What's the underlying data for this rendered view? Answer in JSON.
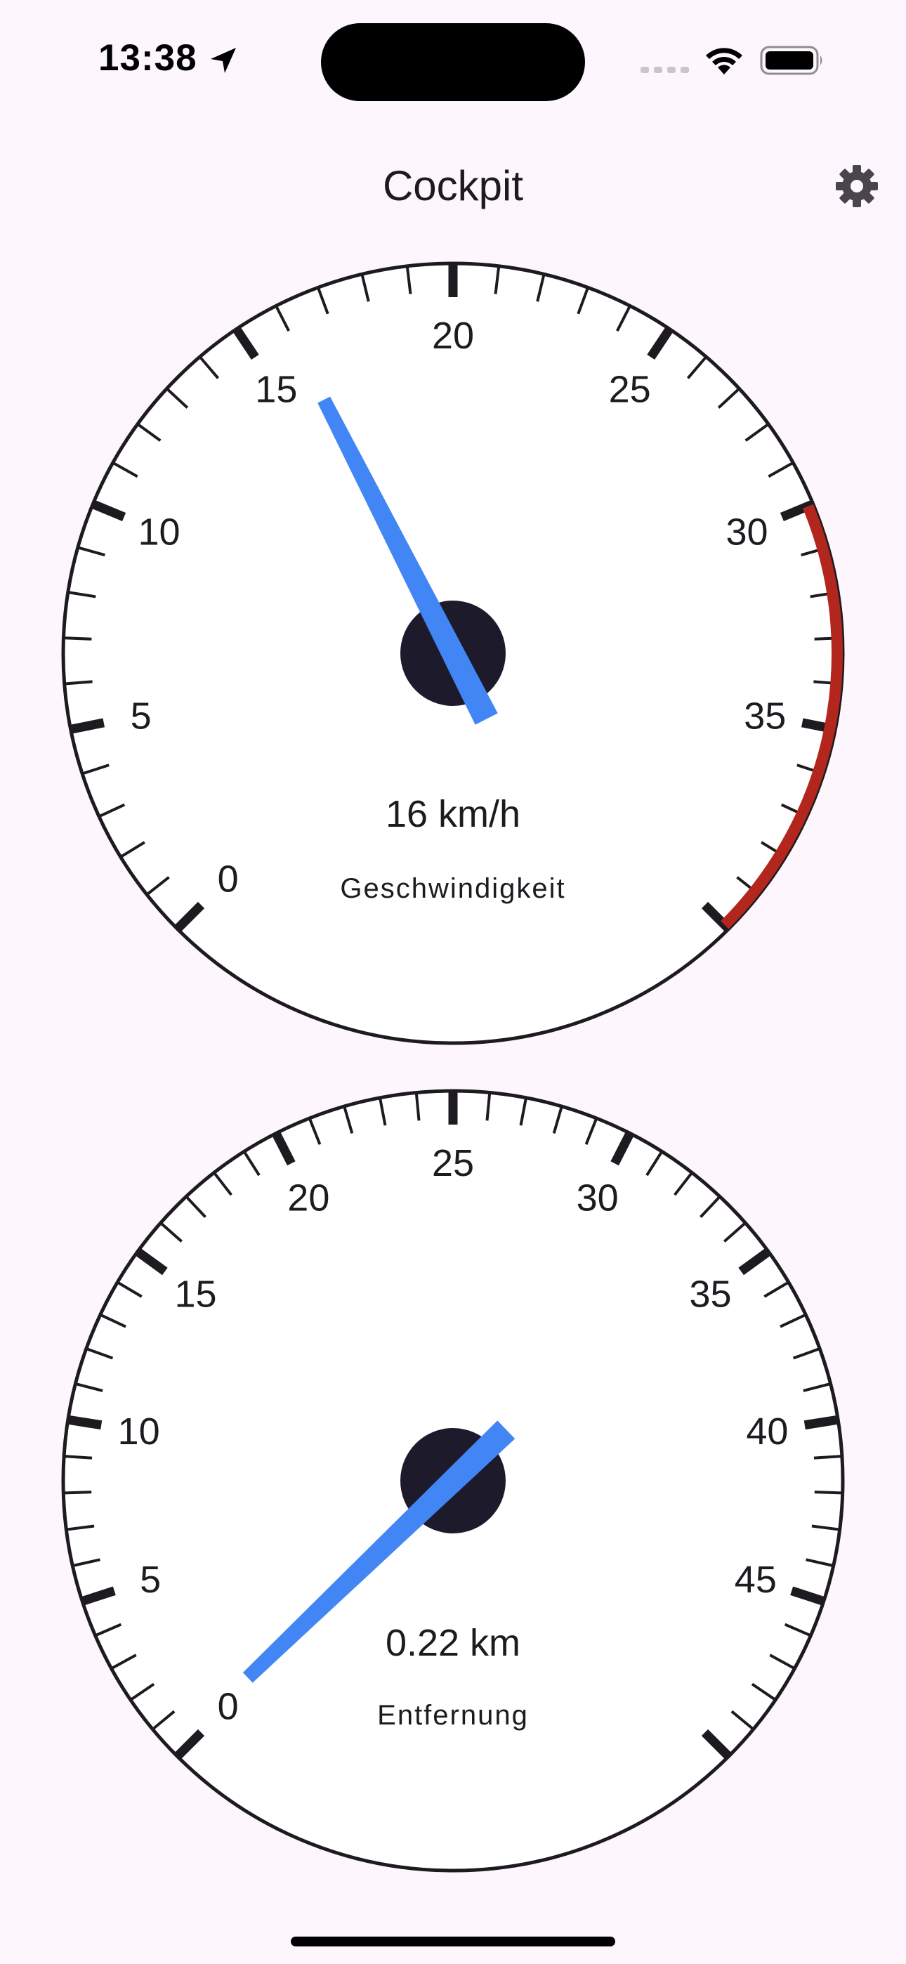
{
  "status_bar": {
    "time": "13:38",
    "icons": [
      "location-arrow-icon",
      "cellular-signal-icon",
      "wifi-icon",
      "battery-icon"
    ]
  },
  "app_bar": {
    "title": "Cockpit",
    "settings_icon": "gear-icon"
  },
  "gauges": [
    {
      "id": "speed",
      "label": "Geschwindigkeit",
      "value_text": "16 km/h",
      "value": 16,
      "min": 0,
      "max": 40,
      "major_ticks": [
        0,
        5,
        10,
        15,
        20,
        25,
        30,
        35
      ],
      "minor_step": 1,
      "warning_from": 30,
      "warning_color": "#b3261e",
      "needle_color": "#4285f4"
    },
    {
      "id": "distance",
      "label": "Entfernung",
      "value_text": "0.22 km",
      "value": 0.22,
      "min": 0,
      "max": 50,
      "major_ticks": [
        0,
        5,
        10,
        15,
        20,
        25,
        30,
        35,
        40,
        45
      ],
      "minor_step": 1,
      "needle_color": "#4285f4"
    }
  ],
  "colors": {
    "background": "#fdf7fd",
    "dial_face": "#ffffff",
    "ink": "#1d1b20",
    "hub": "#1c1a2b"
  }
}
